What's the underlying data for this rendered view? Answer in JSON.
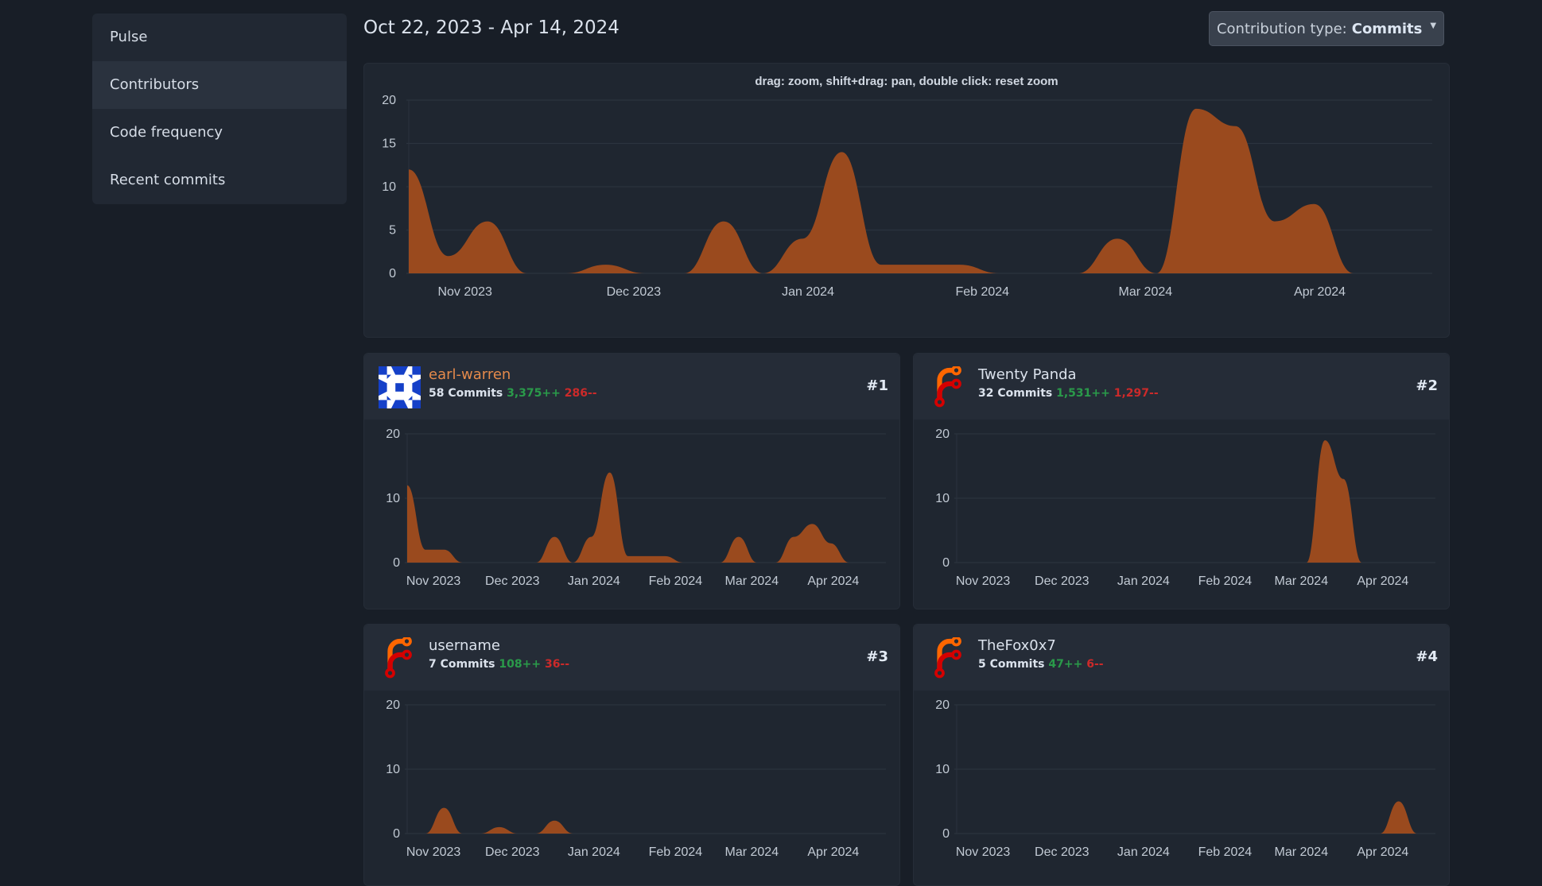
{
  "sidebar": {
    "items": [
      {
        "label": "Pulse",
        "active": false
      },
      {
        "label": "Contributors",
        "active": true
      },
      {
        "label": "Code frequency",
        "active": false
      },
      {
        "label": "Recent commits",
        "active": false
      }
    ]
  },
  "header": {
    "date_range": "Oct 22, 2023 - Apr 14, 2024",
    "contribution_type_label": "Contribution type:",
    "contribution_type_value": "Commits"
  },
  "colors": {
    "area_fill": "#9a4a1e",
    "grid": "#2b333e",
    "tick_text": "#c2cad4",
    "additions": "#2a9a4a",
    "deletions": "#cc2a2a"
  },
  "chart_data": [
    {
      "type": "area",
      "title": "drag: zoom, shift+drag: pan, double click: reset zoom",
      "id": "overview",
      "x_start": "2023-10-22",
      "x_step": "week",
      "x_ticks": [
        "Nov 2023",
        "Dec 2023",
        "Jan 2024",
        "Feb 2024",
        "Mar 2024",
        "Apr 2024"
      ],
      "x_tick_dates": [
        "2023-11-01",
        "2023-12-01",
        "2024-01-01",
        "2024-02-01",
        "2024-03-01",
        "2024-04-01"
      ],
      "y_ticks": [
        0,
        5,
        10,
        15,
        20
      ],
      "ylim": [
        0,
        20
      ],
      "values": [
        12,
        2,
        6,
        0,
        0,
        1,
        0,
        0,
        6,
        0,
        4,
        14,
        1,
        1,
        1,
        0,
        0,
        0,
        4,
        0,
        19,
        17,
        6,
        8,
        0,
        0,
        0
      ]
    },
    {
      "type": "area",
      "id": "earl-warren",
      "x_start": "2023-10-22",
      "x_step": "week",
      "x_ticks": [
        "Nov 2023",
        "Dec 2023",
        "Jan 2024",
        "Feb 2024",
        "Mar 2024",
        "Apr 2024"
      ],
      "x_tick_dates": [
        "2023-11-01",
        "2023-12-01",
        "2024-01-01",
        "2024-02-01",
        "2024-03-01",
        "2024-04-01"
      ],
      "y_ticks": [
        0,
        10,
        20
      ],
      "ylim": [
        0,
        20
      ],
      "values": [
        12,
        2,
        2,
        0,
        0,
        0,
        0,
        0,
        4,
        0,
        4,
        14,
        1,
        1,
        1,
        0,
        0,
        0,
        4,
        0,
        0,
        4,
        6,
        3,
        0,
        0,
        0
      ]
    },
    {
      "type": "area",
      "id": "twenty-panda",
      "x_start": "2023-10-22",
      "x_step": "week",
      "x_ticks": [
        "Nov 2023",
        "Dec 2023",
        "Jan 2024",
        "Feb 2024",
        "Mar 2024",
        "Apr 2024"
      ],
      "x_tick_dates": [
        "2023-11-01",
        "2023-12-01",
        "2024-01-01",
        "2024-02-01",
        "2024-03-01",
        "2024-04-01"
      ],
      "y_ticks": [
        0,
        10,
        20
      ],
      "ylim": [
        0,
        20
      ],
      "values": [
        0,
        0,
        0,
        0,
        0,
        0,
        0,
        0,
        0,
        0,
        0,
        0,
        0,
        0,
        0,
        0,
        0,
        0,
        0,
        0,
        19,
        13,
        0,
        0,
        0,
        0,
        0
      ]
    },
    {
      "type": "area",
      "id": "username",
      "x_start": "2023-10-22",
      "x_step": "week",
      "x_ticks": [
        "Nov 2023",
        "Dec 2023",
        "Jan 2024",
        "Feb 2024",
        "Mar 2024",
        "Apr 2024"
      ],
      "x_tick_dates": [
        "2023-11-01",
        "2023-12-01",
        "2024-01-01",
        "2024-02-01",
        "2024-03-01",
        "2024-04-01"
      ],
      "y_ticks": [
        0,
        10,
        20
      ],
      "ylim": [
        0,
        20
      ],
      "values": [
        0,
        0,
        4,
        0,
        0,
        1,
        0,
        0,
        2,
        0,
        0,
        0,
        0,
        0,
        0,
        0,
        0,
        0,
        0,
        0,
        0,
        0,
        0,
        0,
        0,
        0,
        0
      ]
    },
    {
      "type": "area",
      "id": "thefox0x7",
      "x_start": "2023-10-22",
      "x_step": "week",
      "x_ticks": [
        "Nov 2023",
        "Dec 2023",
        "Jan 2024",
        "Feb 2024",
        "Mar 2024",
        "Apr 2024"
      ],
      "x_tick_dates": [
        "2023-11-01",
        "2023-12-01",
        "2024-01-01",
        "2024-02-01",
        "2024-03-01",
        "2024-04-01"
      ],
      "y_ticks": [
        0,
        10,
        20
      ],
      "ylim": [
        0,
        20
      ],
      "values": [
        0,
        0,
        0,
        0,
        0,
        0,
        0,
        0,
        0,
        0,
        0,
        0,
        0,
        0,
        0,
        0,
        0,
        0,
        0,
        0,
        0,
        0,
        0,
        0,
        5,
        0,
        0
      ]
    }
  ],
  "contributors": [
    {
      "name": "earl-warren",
      "is_link": true,
      "avatar": "identicon",
      "commits": "58 Commits",
      "additions": "3,375++",
      "deletions": "286--",
      "rank": "#1"
    },
    {
      "name": "Twenty Panda",
      "is_link": false,
      "avatar": "forgejo-logo",
      "commits": "32 Commits",
      "additions": "1,531++",
      "deletions": "1,297--",
      "rank": "#2"
    },
    {
      "name": "username",
      "is_link": false,
      "avatar": "forgejo-logo",
      "commits": "7 Commits",
      "additions": "108++",
      "deletions": "36--",
      "rank": "#3"
    },
    {
      "name": "TheFox0x7",
      "is_link": false,
      "avatar": "forgejo-logo",
      "commits": "5 Commits",
      "additions": "47++",
      "deletions": "6--",
      "rank": "#4"
    }
  ]
}
